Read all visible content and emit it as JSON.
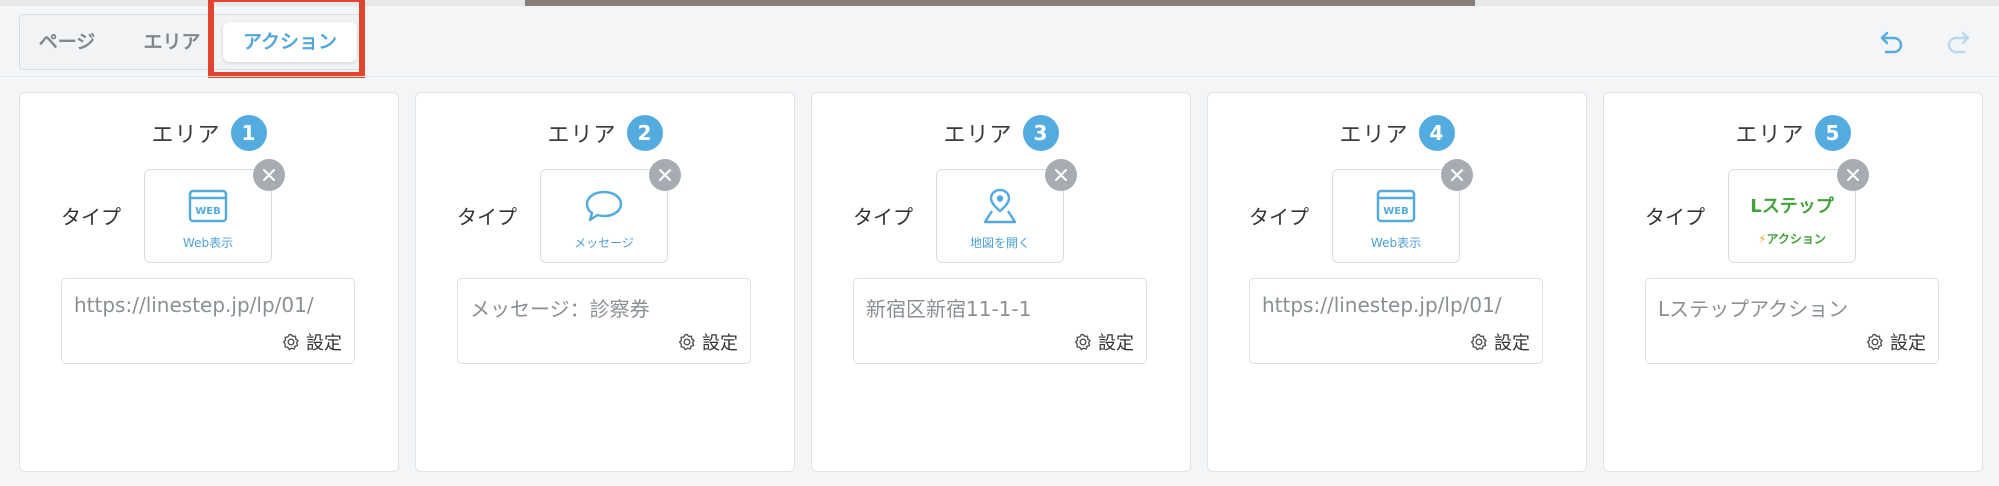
{
  "tabs": [
    {
      "label": "ページ",
      "active": false
    },
    {
      "label": "エリア",
      "active": false
    },
    {
      "label": "アクション",
      "active": true
    }
  ],
  "history": {
    "undo_icon": "undo-icon",
    "redo_icon": "redo-icon"
  },
  "colors": {
    "accent": "#54abdf",
    "highlight": "#e2452e",
    "lstep_green": "#3fa23a"
  },
  "areas": [
    {
      "title": "エリア",
      "number": "1",
      "type_label": "タイプ",
      "type_icon": "web-icon",
      "type_caption": "Web表示",
      "value": "https://linestep.jp/lp/01/",
      "settings_label": "設定"
    },
    {
      "title": "エリア",
      "number": "2",
      "type_label": "タイプ",
      "type_icon": "message-icon",
      "type_caption": "メッセージ",
      "value": "メッセージ：診察券",
      "settings_label": "設定"
    },
    {
      "title": "エリア",
      "number": "3",
      "type_label": "タイプ",
      "type_icon": "map-pin-icon",
      "type_caption": "地図を開く",
      "value": "新宿区新宿11-1-1",
      "settings_label": "設定"
    },
    {
      "title": "エリア",
      "number": "4",
      "type_label": "タイプ",
      "type_icon": "web-icon",
      "type_caption": "Web表示",
      "value": "https://linestep.jp/lp/01/",
      "settings_label": "設定"
    },
    {
      "title": "エリア",
      "number": "5",
      "type_label": "タイプ",
      "type_icon": "lstep-logo-icon",
      "type_title": "Lステップ",
      "type_caption": "アクション",
      "value": "Lステップアクション",
      "settings_label": "設定"
    }
  ]
}
